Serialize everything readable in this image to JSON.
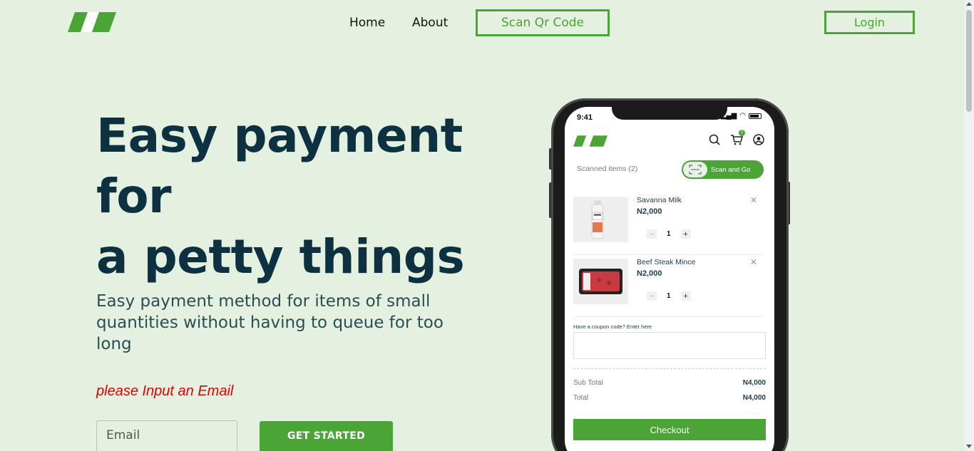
{
  "nav": {
    "home": "Home",
    "about": "About",
    "scan": "Scan Qr Code",
    "login": "Login"
  },
  "hero": {
    "title_line1": "Easy payment for",
    "title_line2": "a petty things",
    "subtitle": "Easy payment method for items of small quantities without having to queue for too long",
    "error": "please Input an Email",
    "email_placeholder": "Email",
    "cta": "GET STARTED"
  },
  "phone": {
    "time": "9:41",
    "cart_count": "2",
    "scanned_label": "Scanned items (2)",
    "scan_go": "Scan and Go",
    "items": [
      {
        "name": "Savanna Milk",
        "price": "N2,000",
        "qty": "1"
      },
      {
        "name": "Beef Steak Mince",
        "price": "N2,000",
        "qty": "1"
      }
    ],
    "coupon_label": "Have a coupon code? Enter here",
    "subtotal_label": "Sub Total",
    "subtotal_value": "N4,000",
    "total_label": "Total",
    "total_value": "N4,000",
    "checkout": "Checkout"
  },
  "colors": {
    "brand_green": "#4aa436",
    "background": "#e4f1e0",
    "heading": "#0d3140",
    "error": "#e00000"
  },
  "icons": [
    "logo-icon",
    "search-icon",
    "cart-icon",
    "user-icon",
    "scan-icon",
    "close-icon",
    "plus-icon",
    "minus-icon"
  ]
}
